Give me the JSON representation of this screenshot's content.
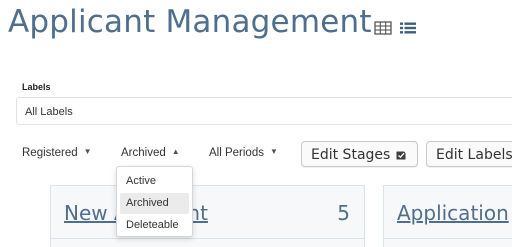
{
  "header": {
    "title": "Applicant Management",
    "views": [
      {
        "name": "grid-view",
        "icon": "grid-icon"
      },
      {
        "name": "list-view",
        "icon": "list-icon"
      }
    ]
  },
  "labels": {
    "heading": "Labels",
    "selected": "All Labels"
  },
  "filters": {
    "registered": "Registered",
    "archived": "Archived",
    "periods": "All Periods",
    "caret_down": "▼",
    "caret_up": "▲"
  },
  "toolbar": {
    "edit_stages": "Edit Stages",
    "edit_labels": "Edit Labels"
  },
  "archived_menu": {
    "options": [
      "Active",
      "Archived",
      "Deleteable"
    ],
    "selected": "Archived"
  },
  "stages": [
    {
      "title": "New Applicant",
      "count": "5"
    },
    {
      "title": "Application",
      "count": ""
    }
  ],
  "colors": {
    "accent": "#4f6f8c",
    "border": "#dbe3ea",
    "selected_item": "#ebebeb"
  }
}
